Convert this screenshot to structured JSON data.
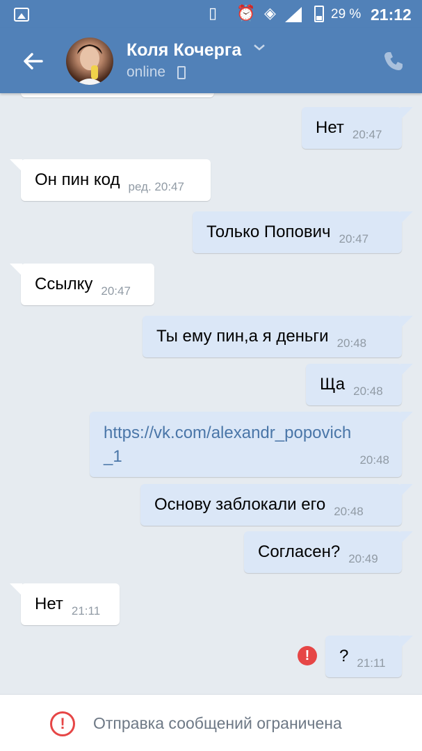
{
  "status_bar": {
    "battery": "29 %",
    "time": "21:12"
  },
  "header": {
    "name": "Коля Кочерга",
    "status": "online",
    "back_icon": "arrow-left-icon",
    "call_icon": "phone-icon",
    "accent": "#5181b8"
  },
  "messages": [
    {
      "dir": "out",
      "text": "Нет",
      "time": "20:47"
    },
    {
      "dir": "in",
      "text": "Он пин код",
      "time": "ред. 20:47"
    },
    {
      "dir": "out",
      "text": "Только Попович",
      "time": "20:47"
    },
    {
      "dir": "in",
      "text": "Ссылку",
      "time": "20:47"
    },
    {
      "dir": "out",
      "text": "Ты ему пин,а я деньги",
      "time": "20:48"
    },
    {
      "dir": "out",
      "text": "Ща",
      "time": "20:48"
    },
    {
      "dir": "out",
      "text": "https://vk.com/alexandr_popovich_1",
      "text_line1": "https://vk.com/alexandr_popovich",
      "text_line2": "_1",
      "time": "20:48",
      "link": true
    },
    {
      "dir": "out",
      "text": "Основу заблокали его",
      "time": "20:48"
    },
    {
      "dir": "out",
      "text": "Согласен?",
      "time": "20:49"
    },
    {
      "dir": "in",
      "text": "Нет",
      "time": "21:11"
    },
    {
      "dir": "out",
      "text": "?",
      "time": "21:11",
      "failed": true
    }
  ],
  "restriction": {
    "text": "Отправка сообщений ограничена",
    "color": "#e64646"
  }
}
